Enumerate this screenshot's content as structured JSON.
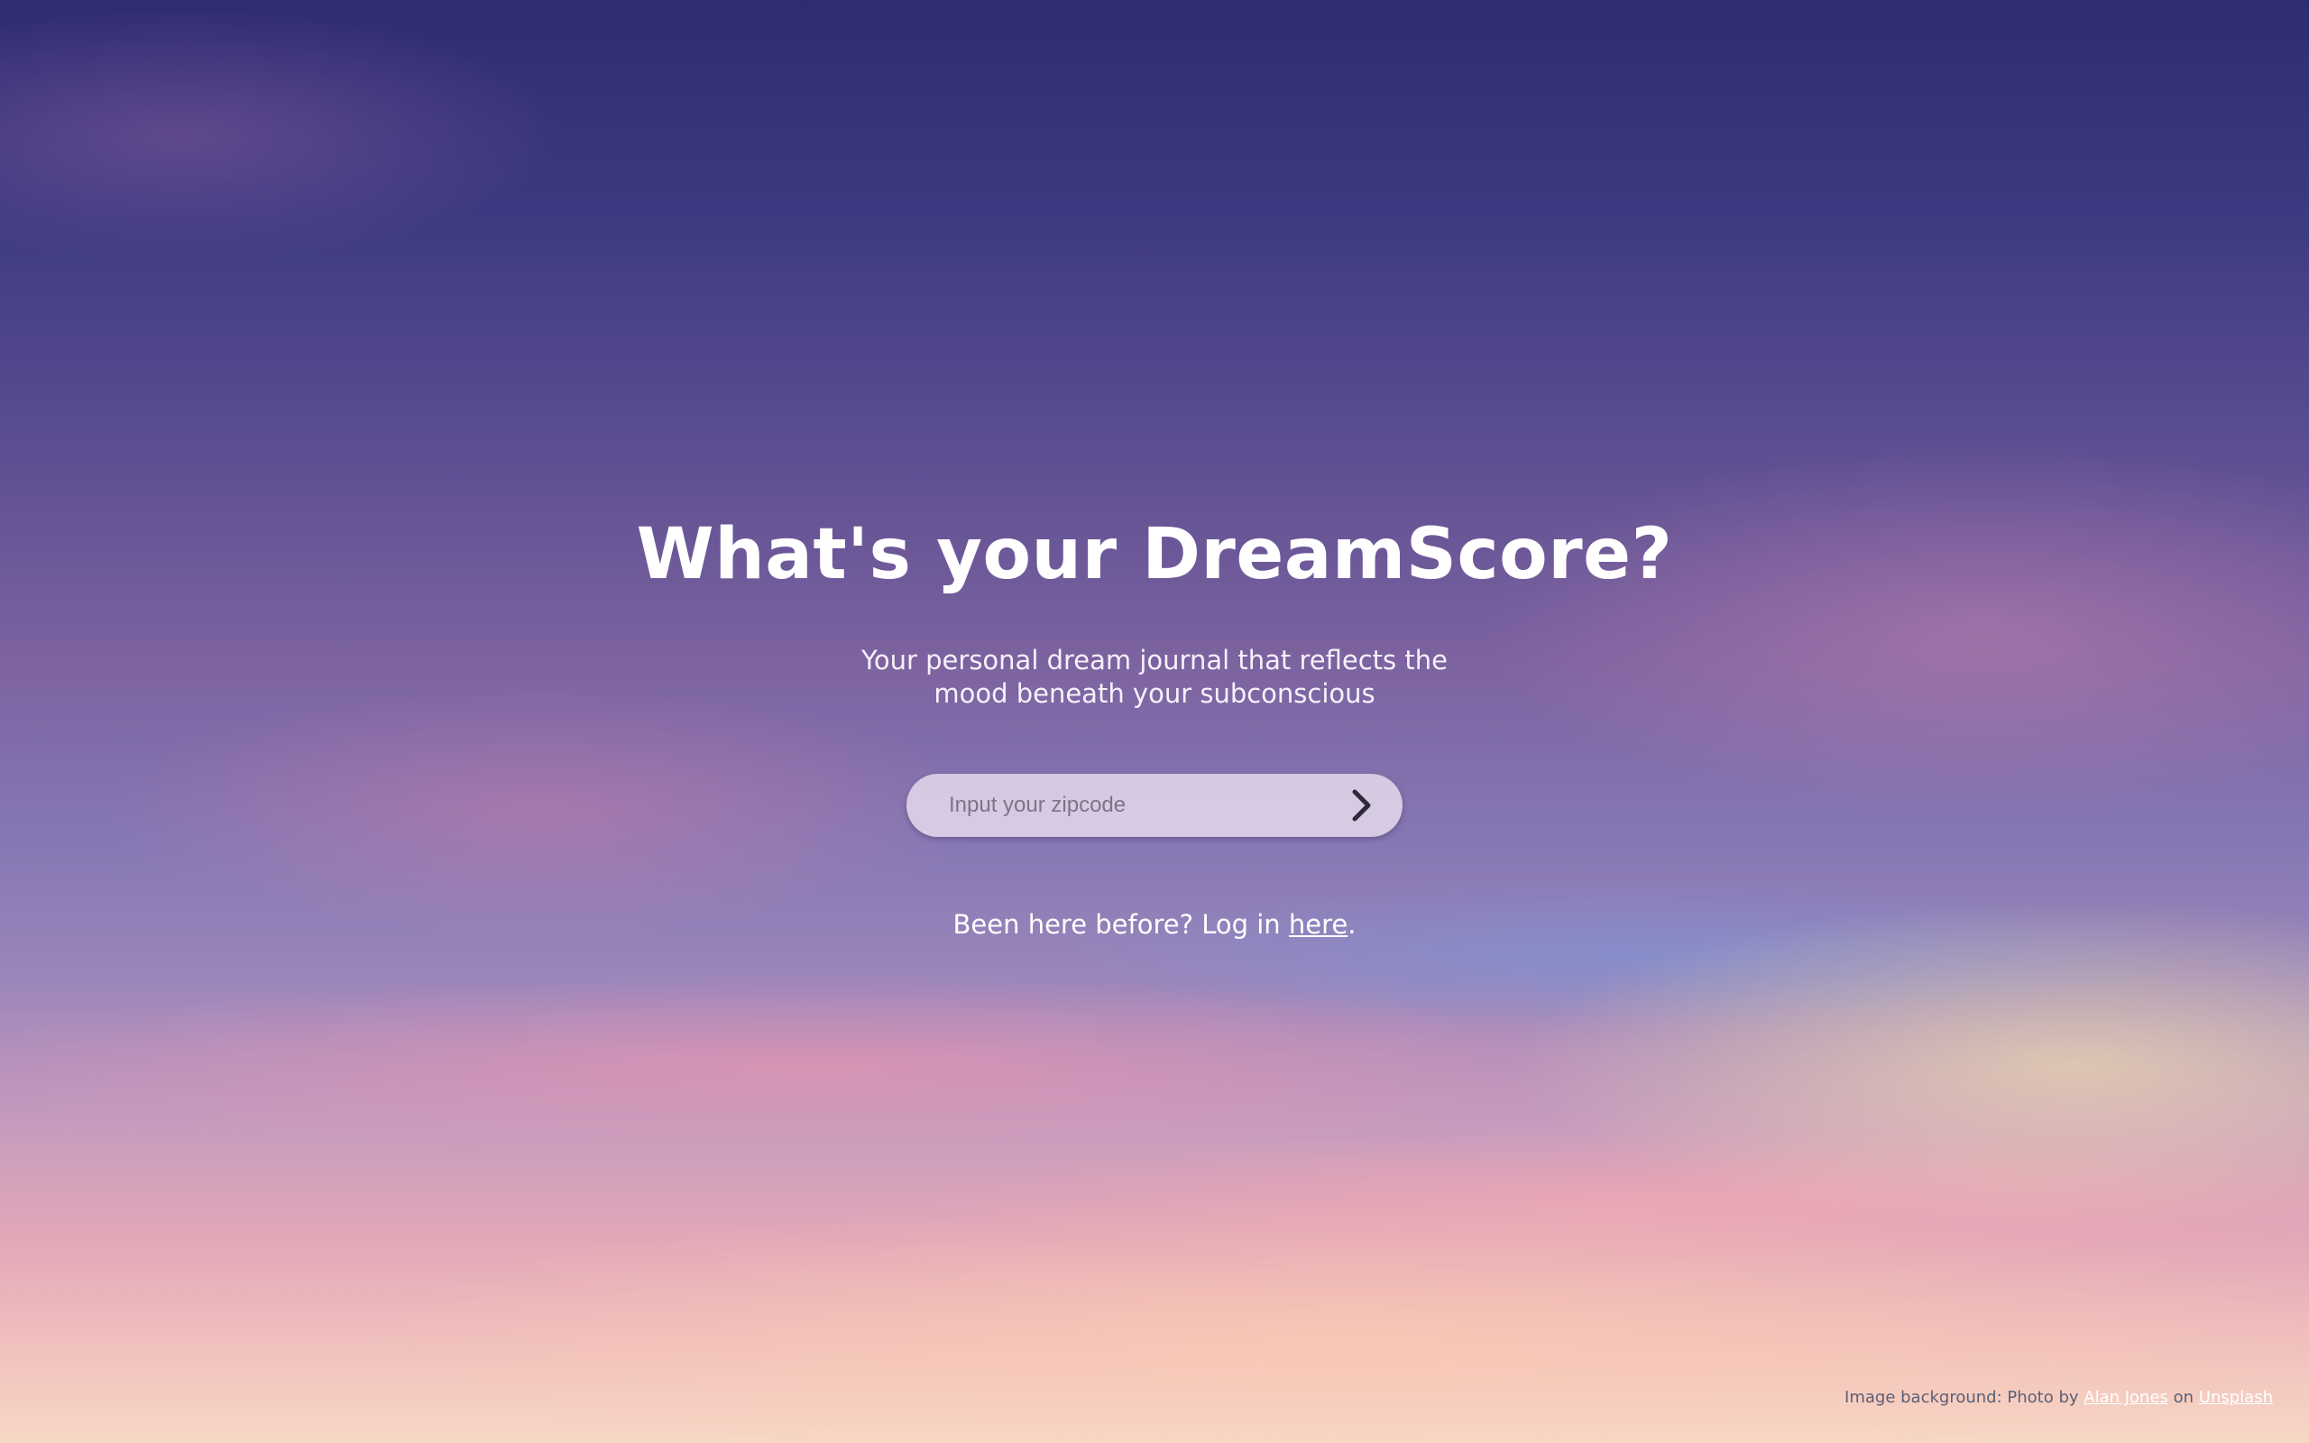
{
  "hero": {
    "title": "What's your DreamScore?",
    "subtitle_line1": "Your personal dream journal that reflects the",
    "subtitle_line2": "mood beneath your subconscious"
  },
  "zip_form": {
    "placeholder": "Input your zipcode",
    "value": "",
    "submit_icon": "chevron-right-icon"
  },
  "login": {
    "prefix": "Been here before? Log in ",
    "link_text": "here",
    "suffix": "."
  },
  "credit": {
    "prefix": "Image background: Photo by ",
    "author": "Alan Jones",
    "middle": " on ",
    "source": "Unsplash"
  },
  "colors": {
    "text": "#ffffff",
    "input_background": "#e8deee",
    "chevron": "#2e2a3a"
  }
}
